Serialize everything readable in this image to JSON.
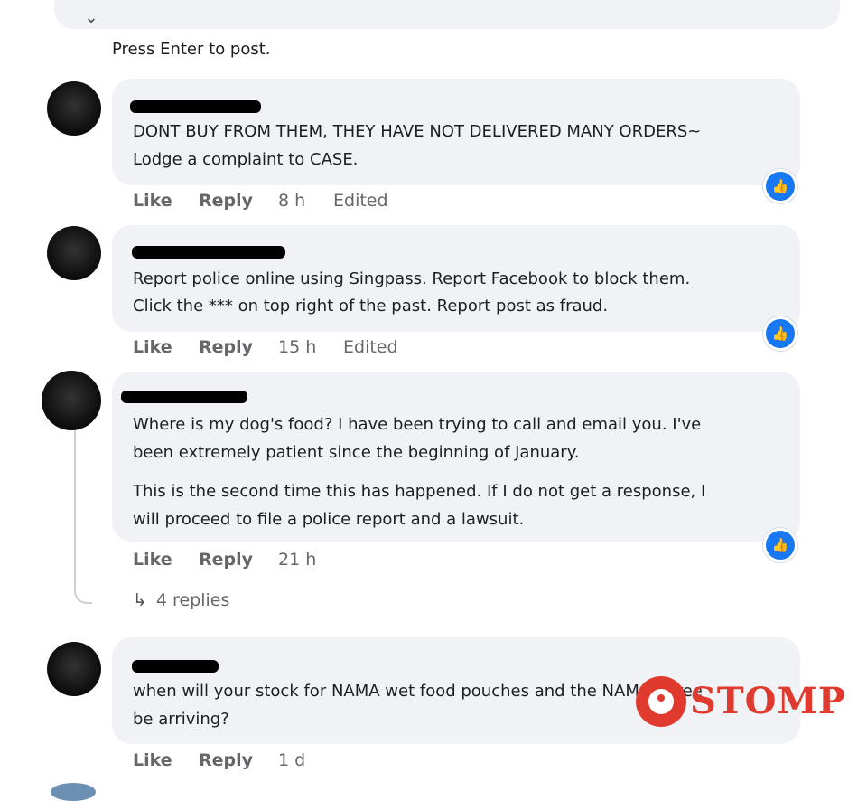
{
  "composer": {
    "hint": "Press Enter to post.",
    "chevron_icon": "chevron-down-icon"
  },
  "comments": [
    {
      "lines": [
        "DONT BUY FROM THEM, THEY HAVE NOT DELIVERED MANY ORDERS~",
        "Lodge a complaint to CASE."
      ],
      "like": "Like",
      "reply": "Reply",
      "time": "8 h",
      "edited": "Edited"
    },
    {
      "lines": [
        "Report police online using Singpass. Report Facebook to block them.",
        "Click the *** on top right of the past. Report post as fraud."
      ],
      "like": "Like",
      "reply": "Reply",
      "time": "15 h",
      "edited": "Edited"
    },
    {
      "lines": [
        "Where is my dog's food? I have been trying to call and email you. I've",
        "been extremely patient since the beginning of January.",
        "This is the second time this has happened. If I do not get a response, I",
        "will proceed to file a police report and a lawsuit."
      ],
      "like": "Like",
      "reply": "Reply",
      "time": "21 h",
      "replies": "4 replies"
    },
    {
      "lines": [
        "when will your stock for NAMA wet food pouches and the NAMA puree",
        "be arriving?"
      ],
      "like": "Like",
      "reply": "Reply",
      "time": "1 d"
    }
  ],
  "reaction_icon": "thumbs-up-icon",
  "reaction_color": "#1877f2",
  "watermark": {
    "text": "STOMP",
    "color": "#e03a2e"
  }
}
